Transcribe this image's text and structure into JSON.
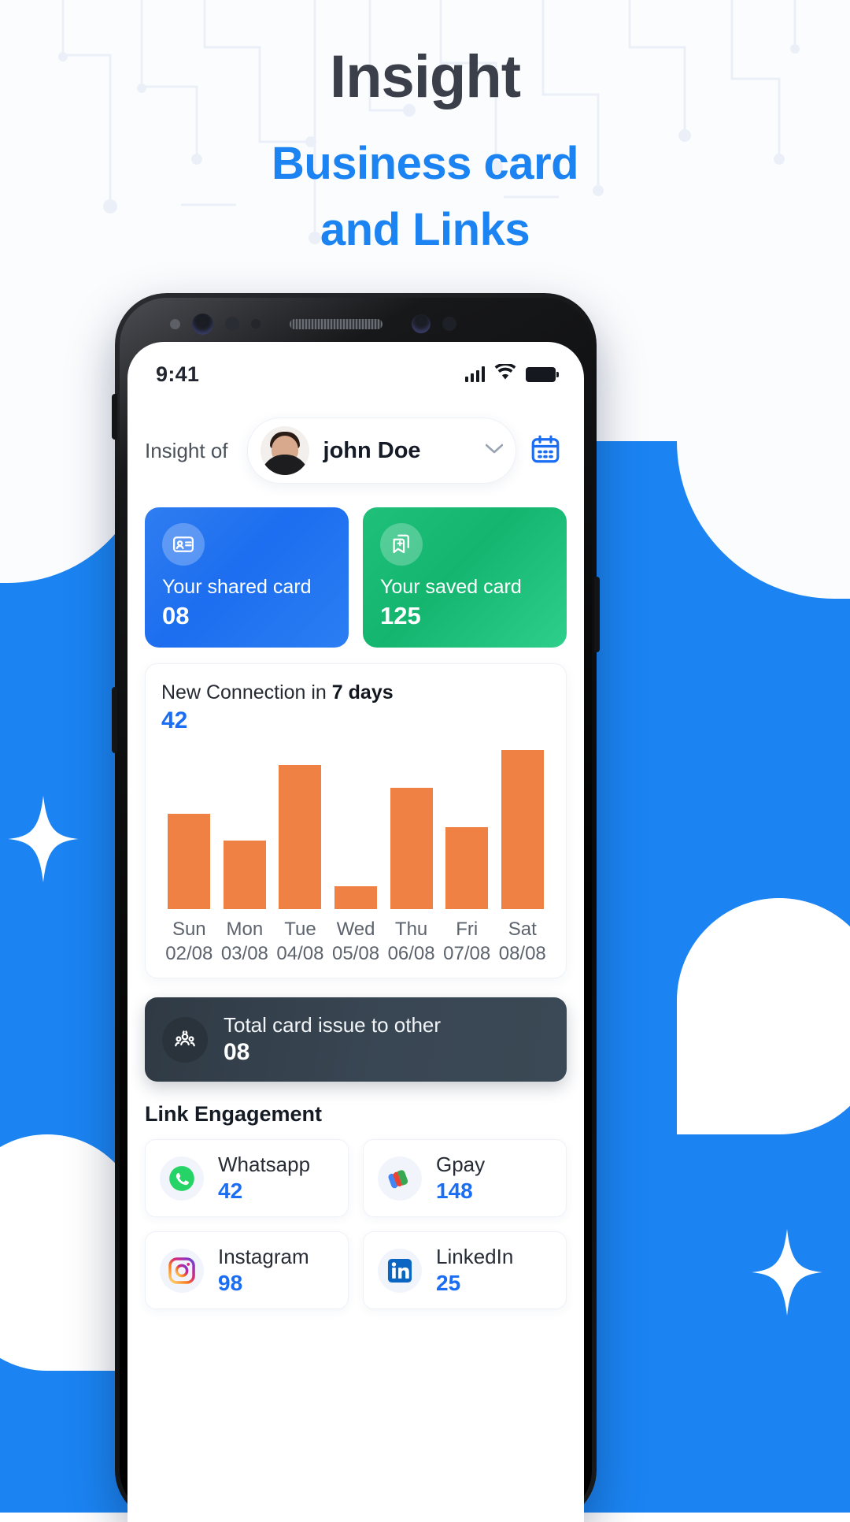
{
  "promo": {
    "title": "Insight",
    "subtitle_line1": "Business card",
    "subtitle_line2": "and Links",
    "accent_color": "#1b84f2",
    "title_color": "#3a3f4a"
  },
  "status_bar": {
    "time": "9:41",
    "signal_icon": "signal-bars-icon",
    "wifi_icon": "wifi-icon",
    "battery_icon": "battery-icon"
  },
  "header": {
    "label": "Insight of",
    "profile_name": "john Doe",
    "avatar_icon": "avatar",
    "dropdown_icon": "chevron-down-icon",
    "calendar_icon": "calendar-icon"
  },
  "stats": [
    {
      "label": "Your shared card",
      "value": "08",
      "icon": "contact-card-icon",
      "color": "#1d6ef0"
    },
    {
      "label": "Your saved card",
      "value": "125",
      "icon": "saved-cards-icon",
      "color": "#13b56f"
    }
  ],
  "chart_card": {
    "title_prefix": "New Connection in ",
    "title_bold": "7 days",
    "value": "42"
  },
  "chart_data": {
    "type": "bar",
    "title": "New Connection in 7 days",
    "categories": [
      "Sun",
      "Mon",
      "Tue",
      "Wed",
      "Thu",
      "Fri",
      "Sat"
    ],
    "dates": [
      "02/08",
      "03/08",
      "04/08",
      "05/08",
      "06/08",
      "07/08",
      "08/08"
    ],
    "values": [
      58,
      42,
      88,
      14,
      74,
      50,
      97
    ],
    "total": 42,
    "xlabel": "",
    "ylabel": "",
    "ylim": [
      0,
      100
    ],
    "grid": false,
    "legend": false,
    "bar_color": "#ee8143"
  },
  "total_banner": {
    "label": "Total card issue to other",
    "value": "08",
    "icon": "people-group-icon"
  },
  "link_engagement": {
    "section_title": "Link Engagement",
    "items": [
      {
        "name": "Whatsapp",
        "value": "42",
        "icon": "whatsapp-icon"
      },
      {
        "name": "Gpay",
        "value": "148",
        "icon": "gpay-icon"
      },
      {
        "name": "Instagram",
        "value": "98",
        "icon": "instagram-icon"
      },
      {
        "name": "LinkedIn",
        "value": "25",
        "icon": "linkedin-icon"
      }
    ]
  }
}
